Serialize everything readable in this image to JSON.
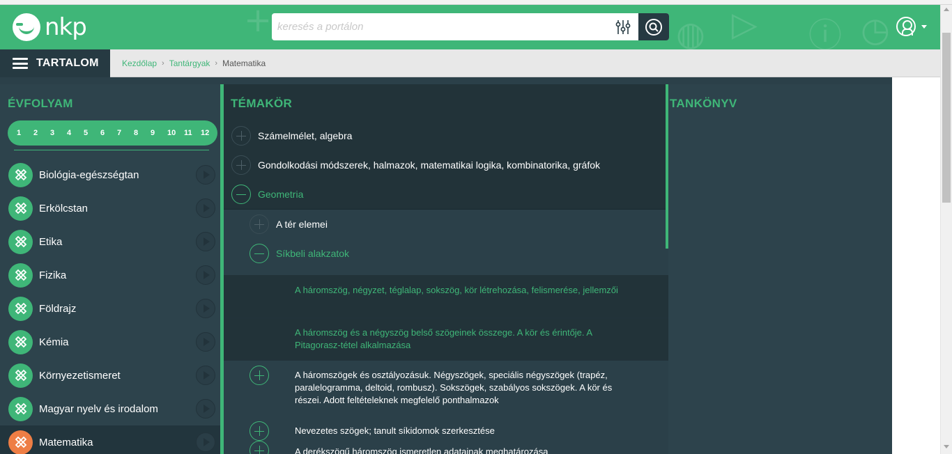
{
  "header": {
    "logo_text": "nkp",
    "search_placeholder": "keresés a portálon",
    "filter_icon": "sliders-icon",
    "search_icon": "search-icon",
    "user_icon": "user-icon",
    "accent_color": "#3fb678"
  },
  "subbar": {
    "menu_label": "TARTALOM",
    "breadcrumb": {
      "home": "Kezdőlap",
      "subjects": "Tantárgyak",
      "current": "Matematika"
    }
  },
  "grades_column": {
    "title": "ÉVFOLYAM",
    "grades": [
      "1",
      "2",
      "3",
      "4",
      "5",
      "6",
      "7",
      "8",
      "9",
      "10",
      "11",
      "12"
    ],
    "subjects": [
      {
        "label": "Biológia-egészségtan",
        "active": false
      },
      {
        "label": "Erkölcstan",
        "active": false
      },
      {
        "label": "Etika",
        "active": false
      },
      {
        "label": "Fizika",
        "active": false
      },
      {
        "label": "Földrajz",
        "active": false
      },
      {
        "label": "Kémia",
        "active": false
      },
      {
        "label": "Környezetismeret",
        "active": false
      },
      {
        "label": "Magyar nyelv és irodalom",
        "active": false
      },
      {
        "label": "Matematika",
        "active": true
      }
    ],
    "active_color": "#ee7e45"
  },
  "topics_column": {
    "title": "TÉMAKÖR",
    "topics": [
      {
        "label": "Számelmélet, algebra",
        "state": "collapsed"
      },
      {
        "label": "Gondolkodási módszerek, halmazok, matematikai logika, kombinatorika, gráfok",
        "state": "collapsed"
      },
      {
        "label": "Geometria",
        "state": "expanded"
      }
    ],
    "subtopics": [
      {
        "label": "A tér elemei",
        "state": "collapsed"
      },
      {
        "label": "Síkbeli alakzatok",
        "state": "expanded"
      }
    ],
    "leaves": [
      {
        "label": "A háromszög, négyzet, téglalap, sokszög, kör létrehozása, felismerése, jellemzői"
      },
      {
        "label": "A háromszög és a négyszög belső szögeinek összege. A kör és érintője. A Pitagorasz-tétel alkalmazása"
      }
    ],
    "lower_items": [
      {
        "label": "A háromszögek és osztályozásuk. Négyszögek, speciális négyszögek (trapéz, paralelogramma, deltoid, rombusz). Sokszögek, szabályos sokszögek. A kör és részei. Adott feltételeknek megfelelő ponthalmazok"
      },
      {
        "label": "Nevezetes szögek; tanult síkidomok szerkesztése"
      },
      {
        "label": "A derékszögű háromszög ismeretlen adatainak meghatározása"
      }
    ]
  },
  "textbook_column": {
    "title": "TANKÖNYV"
  }
}
